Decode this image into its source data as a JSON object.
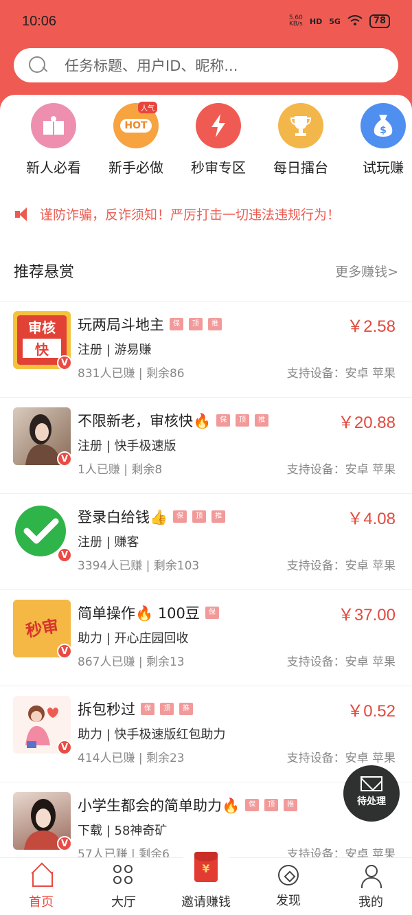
{
  "status_bar": {
    "time": "10:06",
    "net_speed": "5.60",
    "net_unit": "KB/s",
    "hd": "HD",
    "signal": "5G",
    "battery": "78"
  },
  "search": {
    "placeholder": "任务标题、用户ID、昵称..."
  },
  "quick_links": [
    {
      "label": "新人必看",
      "icon": "book-icon"
    },
    {
      "label": "新手必做",
      "icon": "hot-badge-icon",
      "badge": "HOT",
      "badge_top": "人气"
    },
    {
      "label": "秒审专区",
      "icon": "lightning-icon"
    },
    {
      "label": "每日擂台",
      "icon": "trophy-icon"
    },
    {
      "label": "试玩赚",
      "icon": "money-bag-icon"
    }
  ],
  "notice": {
    "text": "谨防诈骗，反诈须知！严厉打击一切违法违规行为！"
  },
  "section": {
    "title": "推荐悬赏",
    "more": "更多赚钱>"
  },
  "tags": {
    "bao": "保",
    "ding": "顶",
    "zhi": "推"
  },
  "tasks": [
    {
      "title": "玩两局斗地主",
      "price": "￥2.58",
      "sub": "注册 | 游易赚",
      "stat": "831人已赚 | 剩余86",
      "device": "支持设备：安卓 苹果",
      "thumb_text_1": "审核",
      "thumb_text_2": "快"
    },
    {
      "title": "不限新老，审核快🔥",
      "price": "￥20.88",
      "sub": "注册 | 快手极速版",
      "stat": "1人已赚 | 剩余8",
      "device": "支持设备：安卓 苹果"
    },
    {
      "title": "登录白给钱👍",
      "price": "￥4.08",
      "sub": "注册 | 赚客",
      "stat": "3394人已赚 | 剩余103",
      "device": "支持设备：安卓 苹果"
    },
    {
      "title": "简单操作🔥 100豆",
      "price": "￥37.00",
      "sub": "助力 | 开心庄园回收",
      "stat": "867人已赚 | 剩余13",
      "device": "支持设备：安卓 苹果",
      "thumb_text_1": "秒审"
    },
    {
      "title": "拆包秒过",
      "price": "￥0.52",
      "sub": "助力 | 快手极速版红包助力",
      "stat": "414人已赚 | 剩余23",
      "device": "支持设备：安卓 苹果"
    },
    {
      "title": "小学生都会的简单助力🔥",
      "price": "",
      "sub": "下载 | 58神奇矿",
      "stat": "57人已赚 | 剩余6",
      "device": "支持设备：安卓 苹果"
    }
  ],
  "badge_v": "V",
  "pending": {
    "label": "待处理"
  },
  "bottom_nav": [
    {
      "label": "首页"
    },
    {
      "label": "大厅"
    },
    {
      "label": "邀请赚钱",
      "coin": "¥"
    },
    {
      "label": "发现"
    },
    {
      "label": "我的"
    }
  ],
  "colors": {
    "brand": "#ef5b53",
    "price": "#e34a3e",
    "tag": "#f29a9a"
  }
}
